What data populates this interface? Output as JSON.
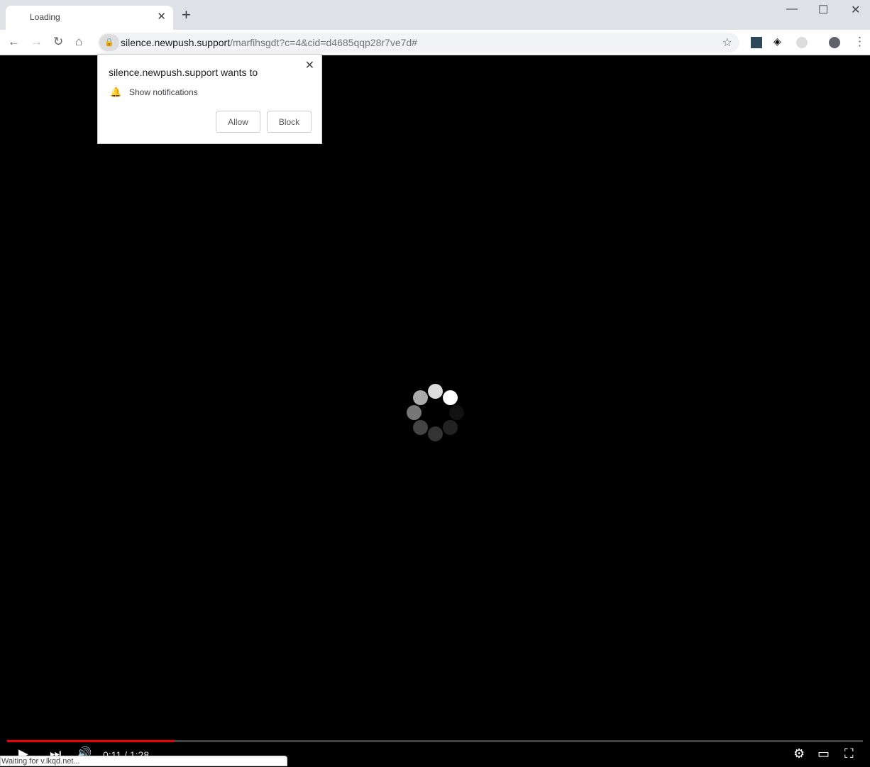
{
  "tab": {
    "title": "Loading",
    "close_icon": "close-icon"
  },
  "window": {
    "minimize": "—",
    "maximize": "☐",
    "close": "✕"
  },
  "address_bar": {
    "domain": "silence.newpush.support",
    "path": "/marfihsgdt?c=4&cid=d4685qqp28r7ve7d#"
  },
  "popup": {
    "title": "silence.newpush.support wants to",
    "permission": "Show notifications",
    "allow": "Allow",
    "block": "Block"
  },
  "player": {
    "time": "0:11 / 1:28",
    "progress": 0.195,
    "accent": "#ee0000"
  },
  "status_bar": {
    "text": "Waiting for v.lkqd.net..."
  }
}
